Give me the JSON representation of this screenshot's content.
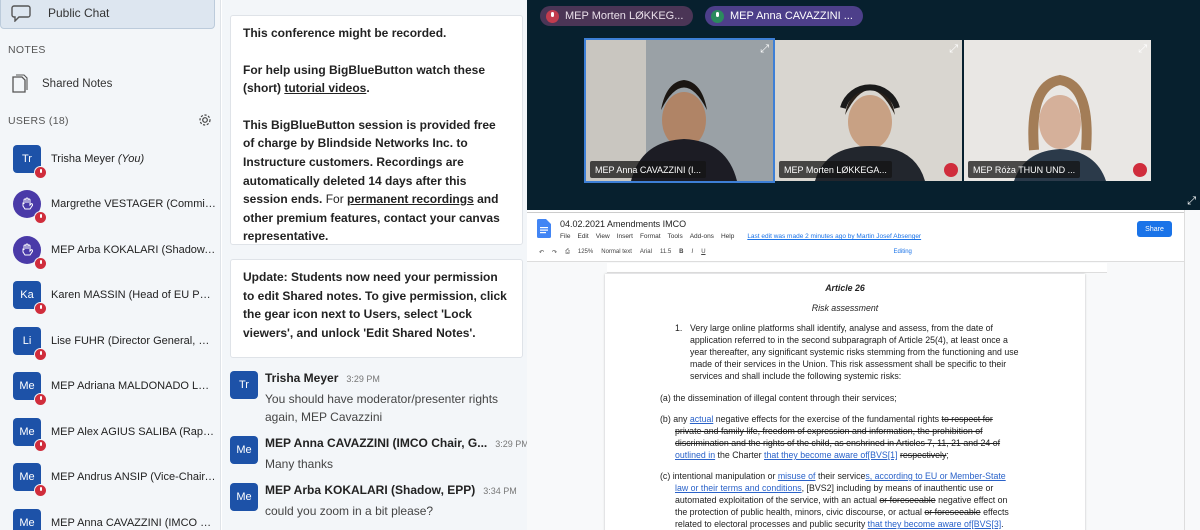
{
  "sidebar": {
    "public_chat": "Public Chat",
    "notes_header": "NOTES",
    "shared_notes": "Shared Notes",
    "users_header": "USERS (18)",
    "users": [
      {
        "initials": "Tr",
        "name": "Trisha Meyer",
        "suffix": " (You)",
        "avatar_type": "square"
      },
      {
        "initials": "",
        "name": "Margrethe VESTAGER (Commissi...",
        "suffix": "",
        "avatar_type": "hand"
      },
      {
        "initials": "",
        "name": "MEP Arba KOKALARI (Shadow, E...",
        "suffix": "",
        "avatar_type": "hand"
      },
      {
        "initials": "Ka",
        "name": "Karen MASSIN (Head of EU Polic...",
        "suffix": "",
        "avatar_type": "square"
      },
      {
        "initials": "Li",
        "name": "Lise FUHR (Director General, ET...",
        "suffix": "",
        "avatar_type": "square"
      },
      {
        "initials": "Me",
        "name": "MEP Adriana MALDONADO LÓPE...",
        "suffix": "",
        "avatar_type": "square"
      },
      {
        "initials": "Me",
        "name": "MEP Alex AGIUS SALIBA (Rappor...",
        "suffix": "",
        "avatar_type": "square"
      },
      {
        "initials": "Me",
        "name": "MEP Andrus ANSIP (Vice-Chair, R...",
        "suffix": "",
        "avatar_type": "square"
      },
      {
        "initials": "Me",
        "name": "MEP Anna CAVAZZINI (IMCO Cha...",
        "suffix": "",
        "avatar_type": "square"
      }
    ]
  },
  "chat": {
    "welcome": {
      "p1": "This conference might be recorded.",
      "p2a": "For help using BigBlueButton watch these (short) ",
      "p2link": "tutorial videos",
      "p2b": ".",
      "p3a": "This BigBlueButton session is provided free of charge by Blindside Networks Inc. to Instructure customers. ",
      "p3b": "Recordings are automatically deleted 14 days after this session ends.",
      "p3c": " For ",
      "p3link": "permanent recordings",
      "p3d": " and other premium features, contact your canvas representative."
    },
    "update": "Update: Students now need your permission to edit Shared notes. To give permission, click the gear icon next to Users, select 'Lock viewers', and unlock 'Edit Shared Notes'.",
    "messages": [
      {
        "initials": "Tr",
        "author": "Trisha Meyer",
        "time": "3:29 PM",
        "text": "You should have moderator/presenter rights again, MEP Cavazzini"
      },
      {
        "initials": "Me",
        "author": "MEP Anna CAVAZZINI (IMCO Chair, G...",
        "time": "3:29 PM",
        "text": "Many thanks"
      },
      {
        "initials": "Me",
        "author": "MEP Arba KOKALARI (Shadow, EPP)",
        "time": "3:34 PM",
        "text": "could you zoom in a bit please?"
      }
    ]
  },
  "video": {
    "speakers": [
      "MEP Morten LØKKEG...",
      "MEP Anna CAVAZZINI ..."
    ],
    "tiles": [
      "MEP Anna CAVAZZINI (I...",
      "MEP Morten LØKKEGA...",
      "MEP Róża THUN UND ..."
    ]
  },
  "doc": {
    "title": "04.02.2021 Amendments IMCO",
    "menu": [
      "File",
      "Edit",
      "View",
      "Insert",
      "Format",
      "Tools",
      "Add-ons",
      "Help"
    ],
    "last_edit": "Last edit was made 2 minutes ago by Martin Josef Absenger",
    "share": "Share",
    "zoom": "125%",
    "style": "Normal text",
    "font": "Arial",
    "size": "11.5",
    "mode": "Editing",
    "article": "Article 26",
    "subtitle": "Risk assessment",
    "para1_num": "1.",
    "para1": [
      "Very large online platforms shall identify, analyse and assess, from the date of",
      "application referred to in the second subparagraph of Article 25(4), at least once a",
      "year thereafter, any significant systemic risks stemming from the functioning and use",
      "made of their services in the Union. This risk assessment shall be specific to their",
      "services and shall include the following systemic risks:"
    ],
    "a": "(a) the dissemination of illegal content through their services;",
    "b_pre": "(b) any ",
    "b_actual": "actual",
    "b_mid": " negative effects for the exercise of the fundamental rights ",
    "b_strike1": "to respect for",
    "b_strike2": "private and family life, freedom of expression and information, the prohibition of",
    "b_strike3": "discrimination and the rights of the child, as enshrined in Articles 7, 11, 21 and 24 of",
    "b_ins1": "outlined in",
    "b_mid2": " the Charter ",
    "b_ins2": "that they become aware of[BVS[1]",
    "b_strike4": "respectively",
    "b_end": ";",
    "c_pre": "(c) intentional manipulation or ",
    "c_ins1": "misuse of",
    "c_mid": " their service",
    "c_ins2": "s, according to EU or Member-State",
    "c_ins3": "law or their terms and conditions",
    "c_mid2": ", [BVS2] including by means of inauthentic use or",
    "c_l3a": "automated exploitation of the service, with an actual ",
    "c_l3s": "or foreseeable",
    "c_l3b": " negative effect on",
    "c_l4a": "the protection of public health, minors, civic discourse, or actual ",
    "c_l4s": "or foreseeable",
    "c_l4b": " effects",
    "c_l5a": "related to electoral processes and public security ",
    "c_l5b": "that they become aware of[BVS[3]",
    "c_l5c": "."
  }
}
